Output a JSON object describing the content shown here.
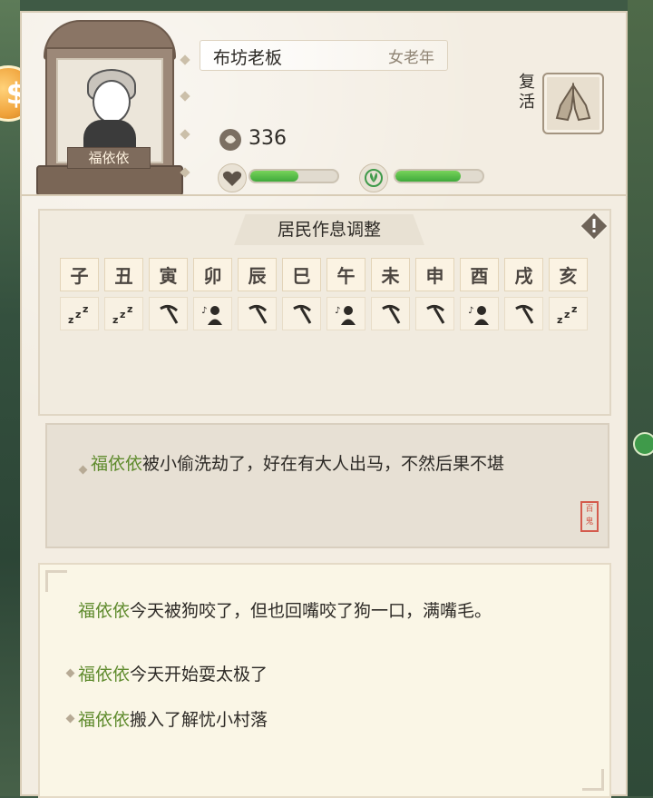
{
  "resident": {
    "name": "福依依",
    "job": "布坊老板",
    "age": "女老年",
    "coins": "336",
    "health_level": 0.55,
    "mood_level": 0.75
  },
  "revive_label": "复活",
  "schedule": {
    "title": "居民作息调整",
    "hours": [
      "子",
      "丑",
      "寅",
      "卯",
      "辰",
      "巳",
      "午",
      "未",
      "申",
      "酉",
      "戌",
      "亥"
    ],
    "activities": [
      "sleep",
      "sleep",
      "work",
      "play",
      "work",
      "work",
      "play",
      "work",
      "work",
      "play",
      "work",
      "sleep"
    ]
  },
  "log": {
    "name": "福依依",
    "text": "被小偷洗劫了，好在有大人出马，不然后果不堪",
    "seal": "百鬼"
  },
  "events": [
    {
      "name": "福依依",
      "text": "今天被狗咬了，但也回嘴咬了狗一口，满嘴毛。"
    },
    {
      "name": "福依依",
      "text": "今天开始耍太极了"
    },
    {
      "name": "福依依",
      "text": "搬入了解忧小村落"
    }
  ],
  "colors": {
    "accent_green": "#5f8b2d",
    "bar_green": "#4cb844"
  }
}
